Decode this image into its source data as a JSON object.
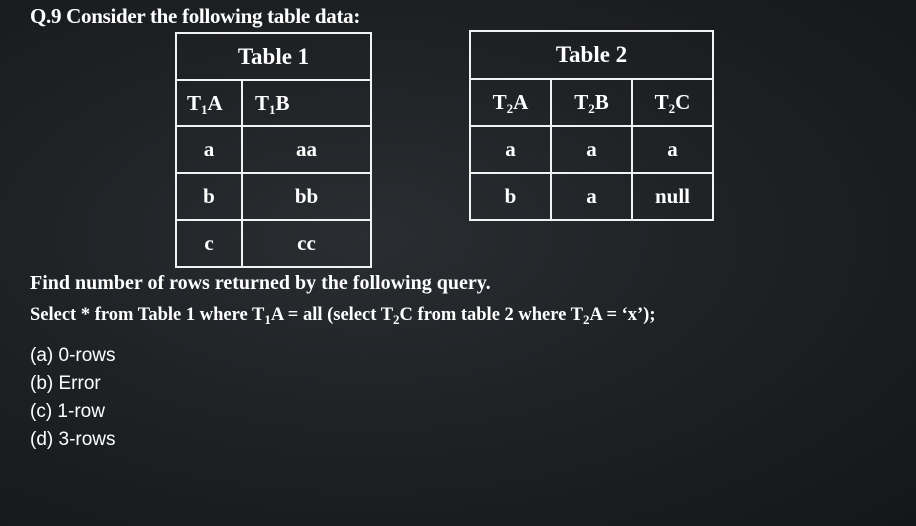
{
  "question": {
    "title": "Q.9 Consider the following table data:",
    "prompt": "Find number of rows returned by the following query."
  },
  "table1": {
    "title": "Table 1",
    "headers": [
      {
        "base": "T",
        "sub": "1",
        "col": "A"
      },
      {
        "base": "T",
        "sub": "1",
        "col": "B"
      }
    ],
    "rows": [
      [
        "a",
        "aa"
      ],
      [
        "b",
        "bb"
      ],
      [
        "c",
        "cc"
      ]
    ]
  },
  "table2": {
    "title": "Table 2",
    "headers": [
      {
        "base": "T",
        "sub": "2",
        "col": "A"
      },
      {
        "base": "T",
        "sub": "2",
        "col": "B"
      },
      {
        "base": "T",
        "sub": "2",
        "col": "C"
      }
    ],
    "rows": [
      [
        "a",
        "a",
        "a"
      ],
      [
        "b",
        "a",
        "null"
      ]
    ]
  },
  "query": {
    "part1": "Select * from Table 1 where T",
    "sub1": "1",
    "part2": "A = all (select T",
    "sub2": "2",
    "part3": "C from table 2 where T",
    "sub3": "2",
    "part4": "A = ‘x’);"
  },
  "options": [
    "(a) 0-rows",
    "(b) Error",
    "(c) 1-row",
    "(d) 3-rows"
  ]
}
